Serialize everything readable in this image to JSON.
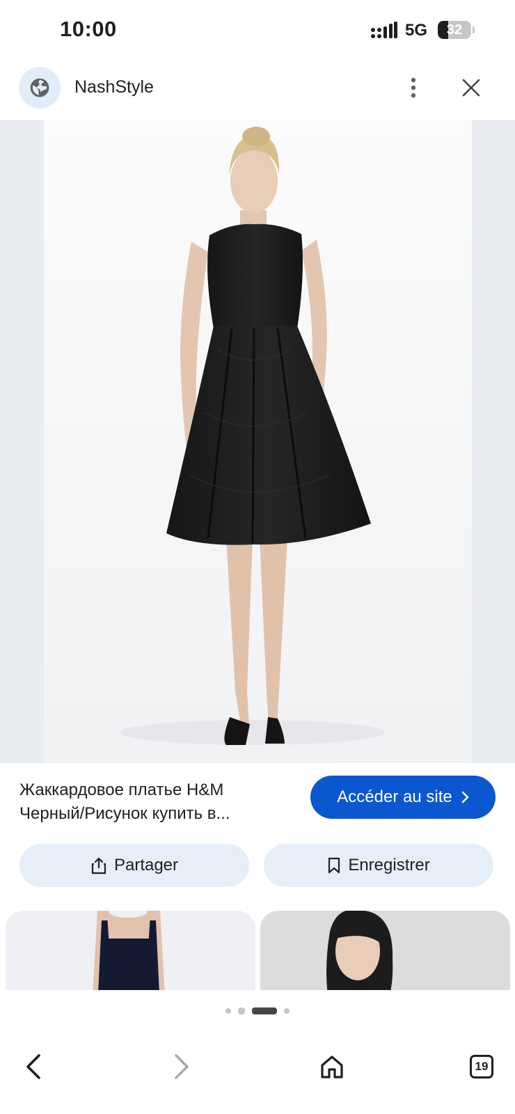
{
  "status_bar": {
    "time": "10:00",
    "network": "5G",
    "battery_level": "32",
    "battery_fraction": 0.32
  },
  "header": {
    "site_name": "NashStyle",
    "site_icon": "globe-icon",
    "more_icon": "more-vert-icon",
    "close_icon": "close-icon"
  },
  "result": {
    "title_line1": "Жаккардовое платье H&M",
    "title_line2": "Черный/Рисунок купить в...",
    "visit_label": "Accéder au site",
    "share_label": "Partager",
    "save_label": "Enregistrer"
  },
  "pager": {
    "page_count": 4,
    "active_index": 2
  },
  "bottom_nav": {
    "back_icon": "chevron-left-icon",
    "forward_icon": "chevron-right-icon",
    "home_icon": "home-icon",
    "tab_count": "19"
  },
  "colors": {
    "accent": "#0b57d0",
    "chip_background": "#e6eef9",
    "image_backdrop": "#e9edf2"
  }
}
